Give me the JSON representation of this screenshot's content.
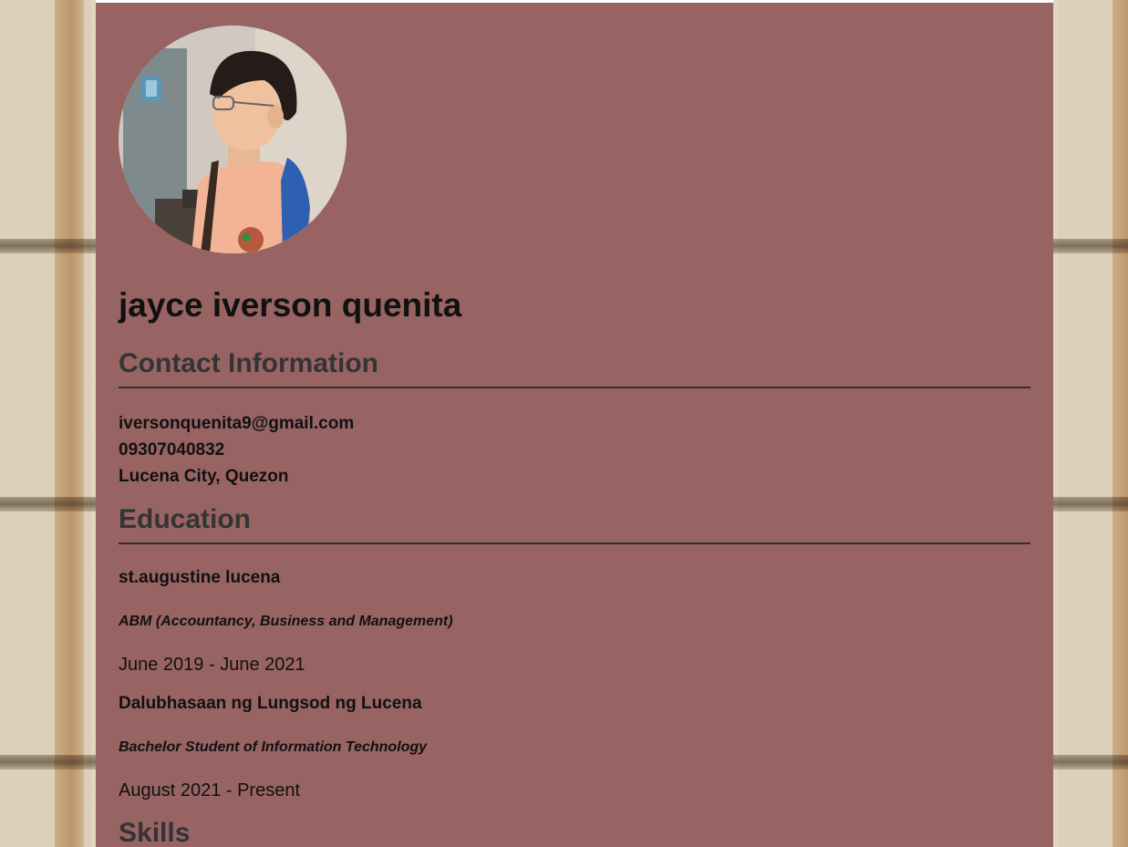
{
  "profile": {
    "name": "jayce iverson quenita",
    "photo_icon": "profile-photo"
  },
  "contact": {
    "heading": "Contact Information",
    "email": "iversonquenita9@gmail.com",
    "phone": "09307040832",
    "location": "Lucena City, Quezon"
  },
  "education": {
    "heading": "Education",
    "entries": [
      {
        "school": "st.augustine lucena",
        "program": "ABM (Accountancy, Business and Management)",
        "dates": "June 2019 - June 2021"
      },
      {
        "school": "Dalubhasaan ng Lungsod ng Lucena",
        "program": "Bachelor Student of Information Technology",
        "dates": "August 2021 - Present"
      }
    ]
  },
  "skills": {
    "heading": "Skills"
  },
  "colors": {
    "panel": "#986363",
    "heading": "#343434",
    "text": "#111111"
  }
}
